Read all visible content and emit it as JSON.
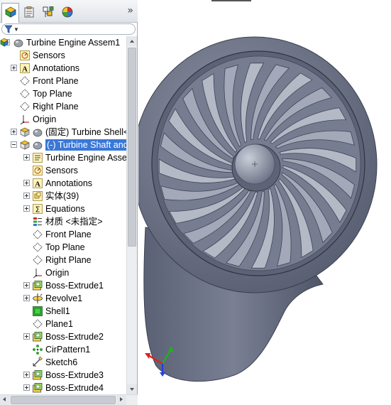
{
  "panel": {
    "tabs": [
      {
        "name": "feature-manager-tab",
        "icon": "feature-tree-icon",
        "active": true
      },
      {
        "name": "property-manager-tab",
        "icon": "property-manager-icon",
        "active": false
      },
      {
        "name": "configuration-manager-tab",
        "icon": "configuration-manager-icon",
        "active": false
      },
      {
        "name": "display-manager-tab",
        "icon": "display-manager-icon",
        "active": false
      }
    ],
    "more_symbol": "»",
    "filter": {
      "icon": "filter-icon",
      "value": ""
    }
  },
  "tree": {
    "items": [
      {
        "label": "Turbine Engine Assem1",
        "icon": "assembly-icon",
        "expander": "minus",
        "level": 0
      },
      {
        "label": "Sensors",
        "icon": "sensors-icon",
        "expander": "",
        "level": 1
      },
      {
        "label": "Annotations",
        "icon": "annotations-icon",
        "expander": "plus",
        "level": 1
      },
      {
        "label": "Front Plane",
        "icon": "plane-icon",
        "expander": "",
        "level": 1
      },
      {
        "label": "Top Plane",
        "icon": "plane-icon",
        "expander": "",
        "level": 1
      },
      {
        "label": "Right Plane",
        "icon": "plane-icon",
        "expander": "",
        "level": 1
      },
      {
        "label": "Origin",
        "icon": "origin-icon",
        "expander": "",
        "level": 1
      },
      {
        "label": "(固定) Turbine Shell<",
        "icon": "part-icon",
        "expander": "plus",
        "level": 1
      },
      {
        "label": "(-) Turbine Shaft and",
        "icon": "part-icon",
        "expander": "minus",
        "level": 1,
        "selected": true
      },
      {
        "label": "Turbine Engine Asse",
        "icon": "history-icon",
        "expander": "plus",
        "level": 2
      },
      {
        "label": "Sensors",
        "icon": "sensors-icon",
        "expander": "",
        "level": 2
      },
      {
        "label": "Annotations",
        "icon": "annotations-icon",
        "expander": "plus",
        "level": 2
      },
      {
        "label": "实体(39)",
        "icon": "solid-bodies-icon",
        "expander": "plus",
        "level": 2
      },
      {
        "label": "Equations",
        "icon": "equations-icon",
        "expander": "plus",
        "level": 2
      },
      {
        "label": "材质 <未指定>",
        "icon": "material-icon",
        "expander": "",
        "level": 2
      },
      {
        "label": "Front Plane",
        "icon": "plane-icon",
        "expander": "",
        "level": 2
      },
      {
        "label": "Top Plane",
        "icon": "plane-icon",
        "expander": "",
        "level": 2
      },
      {
        "label": "Right Plane",
        "icon": "plane-icon",
        "expander": "",
        "level": 2
      },
      {
        "label": "Origin",
        "icon": "origin-icon",
        "expander": "",
        "level": 2
      },
      {
        "label": "Boss-Extrude1",
        "icon": "extrude-icon",
        "expander": "plus",
        "level": 2
      },
      {
        "label": "Revolve1",
        "icon": "revolve-icon",
        "expander": "plus",
        "level": 2
      },
      {
        "label": "Shell1",
        "icon": "shell-icon",
        "expander": "",
        "level": 2
      },
      {
        "label": "Plane1",
        "icon": "plane-icon",
        "expander": "",
        "level": 2
      },
      {
        "label": "Boss-Extrude2",
        "icon": "extrude-icon",
        "expander": "plus",
        "level": 2
      },
      {
        "label": "CirPattern1",
        "icon": "circular-pattern-icon",
        "expander": "",
        "level": 2
      },
      {
        "label": "Sketch6",
        "icon": "sketch-icon",
        "expander": "",
        "level": 2
      },
      {
        "label": "Boss-Extrude3",
        "icon": "extrude-icon",
        "expander": "plus",
        "level": 2
      },
      {
        "label": "Boss-Extrude4",
        "icon": "extrude-icon",
        "expander": "plus",
        "level": 2
      }
    ]
  },
  "viewport": {
    "model": "turbine-fan-model",
    "blade_count": 24,
    "colors": {
      "body": "#6c7285",
      "body_dark": "#4a5063",
      "blade": "#a3a9b8",
      "blade_edge": "#3f4556",
      "hub": "#8e95a6",
      "selection": "#3a78d8"
    },
    "triad": {
      "x_color": "#e02020",
      "y_color": "#20b020",
      "z_color": "#2040e0"
    }
  }
}
